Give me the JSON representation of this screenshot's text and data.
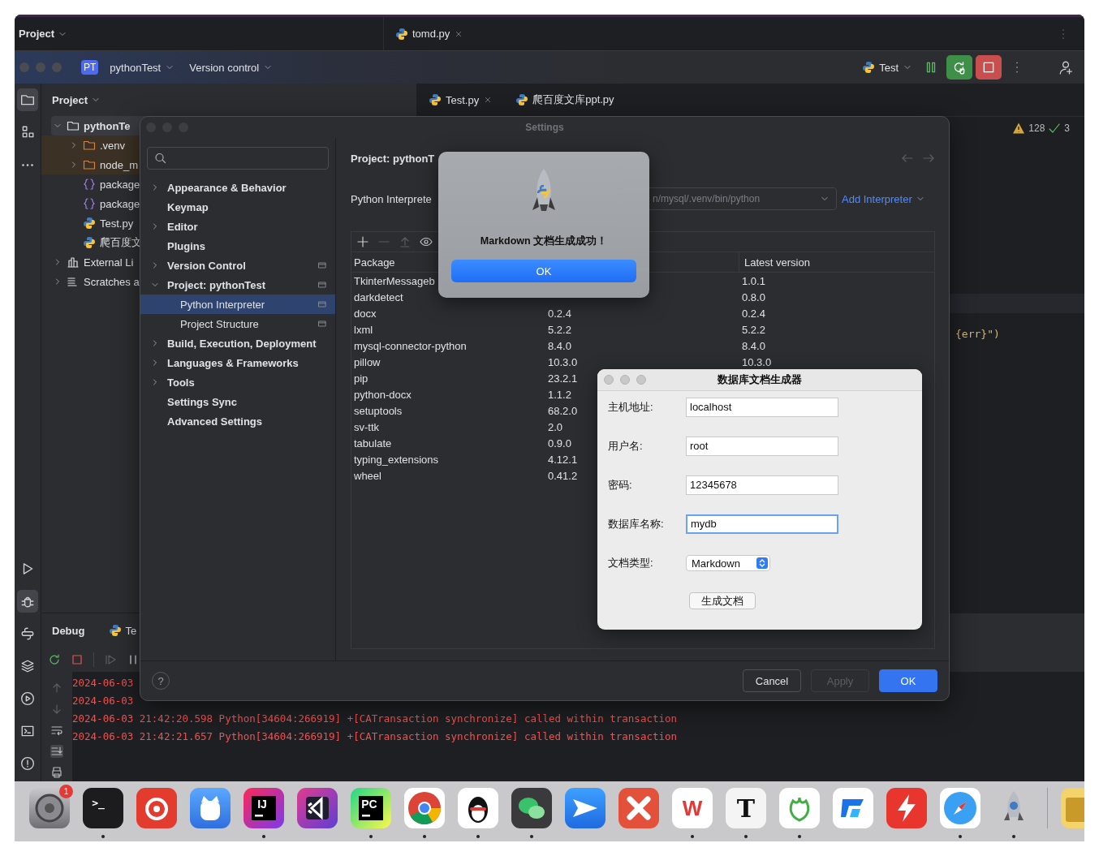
{
  "back_window": {
    "panel_title": "Project",
    "tab": "tomd.py"
  },
  "toolbar": {
    "project_badge": "PT",
    "project": "pythonTest",
    "vcs": "Version control",
    "run_config": "Test"
  },
  "tool_windows_top": [
    {
      "kind": "project",
      "selected": true
    },
    {
      "kind": "structure",
      "selected": false
    },
    {
      "kind": "more",
      "selected": false
    }
  ],
  "tool_windows_bottom": [
    {
      "kind": "run",
      "selected": false
    },
    {
      "kind": "debug",
      "selected": true
    },
    {
      "kind": "python",
      "selected": false
    },
    {
      "kind": "layers",
      "selected": false
    },
    {
      "kind": "services",
      "selected": false
    },
    {
      "kind": "terminal",
      "selected": false
    },
    {
      "kind": "problems",
      "selected": false
    }
  ],
  "project_panel": {
    "title": "Project",
    "tree": [
      {
        "label": "pythonTe",
        "kind": "folder",
        "expanded": true,
        "selected": true,
        "excluded": false,
        "children": [
          {
            "label": ".venv",
            "kind": "folder",
            "expanded": false,
            "selected": false,
            "excluded": true
          },
          {
            "label": "node_m",
            "kind": "folder",
            "expanded": false,
            "selected": false,
            "excluded": true
          },
          {
            "label": "package",
            "kind": "json",
            "selected": false
          },
          {
            "label": "package",
            "kind": "json",
            "selected": false
          },
          {
            "label": "Test.py",
            "kind": "python",
            "selected": false
          },
          {
            "label": "爬百度文",
            "kind": "python",
            "selected": false
          }
        ]
      },
      {
        "label": "External Li",
        "kind": "library",
        "expanded": false,
        "selected": false
      },
      {
        "label": "Scratches a",
        "kind": "scratch",
        "expanded": false,
        "selected": false
      }
    ]
  },
  "editor_tabs": [
    {
      "label": "Test.py",
      "closable": true
    },
    {
      "label": "爬百度文库ppt.py",
      "closable": false
    }
  ],
  "editor": {
    "warnings": "128",
    "checks": "3",
    "code_fragment": "{err}\")"
  },
  "debug": {
    "title": "Debug",
    "tab": "Te",
    "log": [
      "2024-06-03",
      "2024-06-03",
      "2024-06-03 21:42:20.598 Python[34604:266919] +[CATransaction synchronize] called within transaction",
      "2024-06-03 21:42:21.657 Python[34604:266919] +[CATransaction synchronize] called within transaction"
    ]
  },
  "settings": {
    "title": "Settings",
    "nav": [
      {
        "label": "Appearance & Behavior",
        "expanded": false,
        "selected": false
      },
      {
        "label": "Keymap",
        "selected": false
      },
      {
        "label": "Editor",
        "expanded": false,
        "selected": false
      },
      {
        "label": "Plugins",
        "selected": false
      },
      {
        "label": "Version Control",
        "expanded": false,
        "selected": false,
        "scoped": true
      },
      {
        "label": "Project: pythonTest",
        "expanded": true,
        "selected": false,
        "scoped": true,
        "children": [
          {
            "label": "Python Interpreter",
            "selected": true,
            "scoped": true
          },
          {
            "label": "Project Structure",
            "selected": false,
            "scoped": true
          }
        ]
      },
      {
        "label": "Build, Execution, Deployment",
        "expanded": false,
        "selected": false
      },
      {
        "label": "Languages & Frameworks",
        "expanded": false,
        "selected": false
      },
      {
        "label": "Tools",
        "expanded": false,
        "selected": false
      },
      {
        "label": "Settings Sync",
        "selected": false
      },
      {
        "label": "Advanced Settings",
        "selected": false
      }
    ],
    "breadcrumb": "Project: pythonT",
    "interpreter_label": "Python Interprete",
    "interpreter_path": "n/mysql/.venv/bin/python",
    "add_interpreter": "Add Interpreter",
    "columns": [
      "Package",
      "Latest version"
    ],
    "packages": [
      {
        "name": "TkinterMessageb",
        "latest": "1.0.1"
      },
      {
        "name": "darkdetect",
        "latest": "0.8.0"
      },
      {
        "name": "docx",
        "version": "0.2.4",
        "latest": "0.2.4"
      },
      {
        "name": "lxml",
        "version": "5.2.2",
        "latest": "5.2.2"
      },
      {
        "name": "mysql-connector-python",
        "version": "8.4.0",
        "latest": "8.4.0"
      },
      {
        "name": "pillow",
        "version": "10.3.0",
        "latest": "10.3.0"
      },
      {
        "name": "pip",
        "version": "23.2.1"
      },
      {
        "name": "python-docx",
        "version": "1.1.2"
      },
      {
        "name": "setuptools",
        "version": "68.2.0"
      },
      {
        "name": "sv-ttk",
        "version": "2.0"
      },
      {
        "name": "tabulate",
        "version": "0.9.0"
      },
      {
        "name": "typing_extensions",
        "version": "4.12.1"
      },
      {
        "name": "wheel",
        "version": "0.41.2"
      }
    ],
    "help": "?",
    "buttons": [
      {
        "label": "Cancel",
        "kind": "secondary",
        "disabled": false
      },
      {
        "label": "Apply",
        "kind": "secondary",
        "disabled": true
      },
      {
        "label": "OK",
        "kind": "primary",
        "disabled": false
      }
    ]
  },
  "alert": {
    "message": "Markdown 文档生成成功！",
    "button": "OK"
  },
  "generator": {
    "title": "数据库文档生成器",
    "fields": [
      {
        "label": "主机地址:",
        "value": "localhost",
        "focused": false
      },
      {
        "label": "用户名:",
        "value": "root",
        "focused": false
      },
      {
        "label": "密码:",
        "value": "12345678",
        "focused": false
      },
      {
        "label": "数据库名称:",
        "value": "mydb",
        "focused": true
      }
    ],
    "type_label": "文档类型:",
    "type_value": "Markdown",
    "button": "生成文档"
  },
  "dock": [
    {
      "kind": "settings",
      "running": false,
      "badge": "1"
    },
    {
      "kind": "terminal",
      "running": true,
      "glyph": ">_"
    },
    {
      "kind": "music",
      "running": false
    },
    {
      "kind": "cat",
      "running": false
    },
    {
      "kind": "ij",
      "running": true,
      "glyph": "IJ"
    },
    {
      "kind": "vscode",
      "running": false
    },
    {
      "kind": "pc",
      "running": true,
      "glyph": "PC"
    },
    {
      "kind": "chrome",
      "running": true
    },
    {
      "kind": "penguin",
      "running": true
    },
    {
      "kind": "chat",
      "running": true
    },
    {
      "kind": "plane",
      "running": false
    },
    {
      "kind": "xmind",
      "running": false
    },
    {
      "kind": "wps",
      "running": true,
      "glyph": "W"
    },
    {
      "kind": "typora",
      "running": true,
      "glyph": "T"
    },
    {
      "kind": "leaf",
      "running": true
    },
    {
      "kind": "todesk",
      "running": false
    },
    {
      "kind": "flash",
      "running": false
    },
    {
      "kind": "safari",
      "running": true
    },
    {
      "kind": "rocket",
      "running": true
    },
    {
      "kind": "stack",
      "running": false
    }
  ]
}
